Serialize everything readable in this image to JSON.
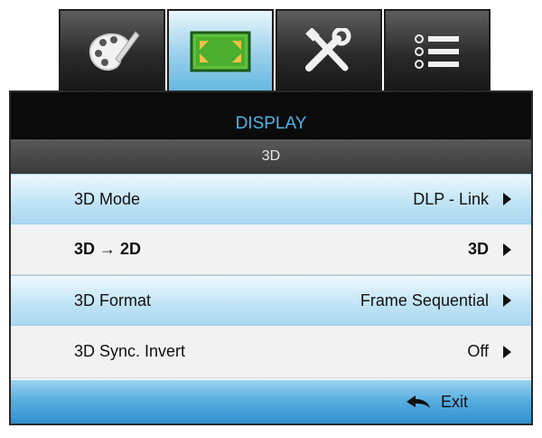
{
  "tabs": [
    {
      "icon": "palette-icon",
      "active": false
    },
    {
      "icon": "display-icon",
      "active": true
    },
    {
      "icon": "tools-icon",
      "active": false
    },
    {
      "icon": "list-icon",
      "active": false
    }
  ],
  "menu": {
    "title": "DISPLAY",
    "subtitle": "3D"
  },
  "rows": [
    {
      "label": "3D Mode",
      "value": "DLP - Link"
    },
    {
      "label": "3D → 2D",
      "value": "3D"
    },
    {
      "label": "3D Format",
      "value": "Frame Sequential"
    },
    {
      "label": "3D Sync. Invert",
      "value": "Off"
    }
  ],
  "footer": {
    "exit_label": "Exit"
  },
  "colors": {
    "title_text": "#4fb3e6",
    "highlight": "#a9d8f0",
    "footer": "#2f8fcf"
  }
}
